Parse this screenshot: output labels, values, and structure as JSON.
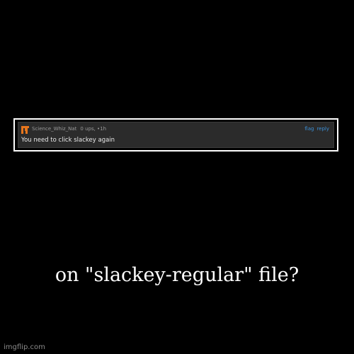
{
  "comment": {
    "username": "Science_Whiz_Nat",
    "ups": "0 ups",
    "time": "1h",
    "flag_label": "flag",
    "reply_label": "reply",
    "text": "You need to click slackey again",
    "avatar_color": "#e8761c",
    "avatar_icon": "orange-pixel-avatar-icon"
  },
  "caption": "on \"slackey-regular\" file?",
  "watermark": "imgflip.com"
}
